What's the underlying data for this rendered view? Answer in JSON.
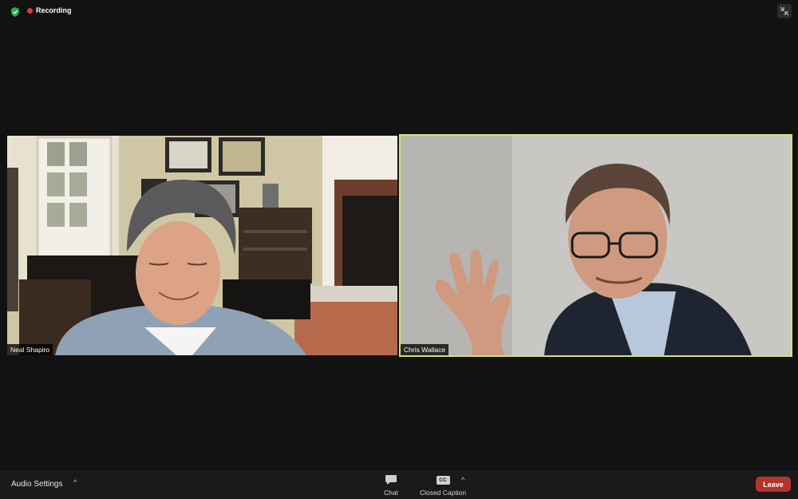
{
  "topbar": {
    "security_icon": "shield-check-icon",
    "recording_label": "Recording",
    "minimize_icon": "exit-fullscreen-icon",
    "colors": {
      "security": "#2ea44f",
      "recording_dot": "#e5383b"
    }
  },
  "participants": [
    {
      "name": "Neal Shapiro",
      "active_speaker": false
    },
    {
      "name": "Chris Wallace",
      "active_speaker": true,
      "highlight_color": "#d2e07e"
    }
  ],
  "toolbar": {
    "audio_settings_label": "Audio Settings",
    "audio_caret": "^",
    "chat_label": "Chat",
    "chat_icon": "chat-bubble-icon",
    "closed_caption_label": "Closed Caption",
    "cc_badge": "CC",
    "cc_caret": "^",
    "leave_label": "Leave",
    "leave_color": "#b5332e"
  }
}
